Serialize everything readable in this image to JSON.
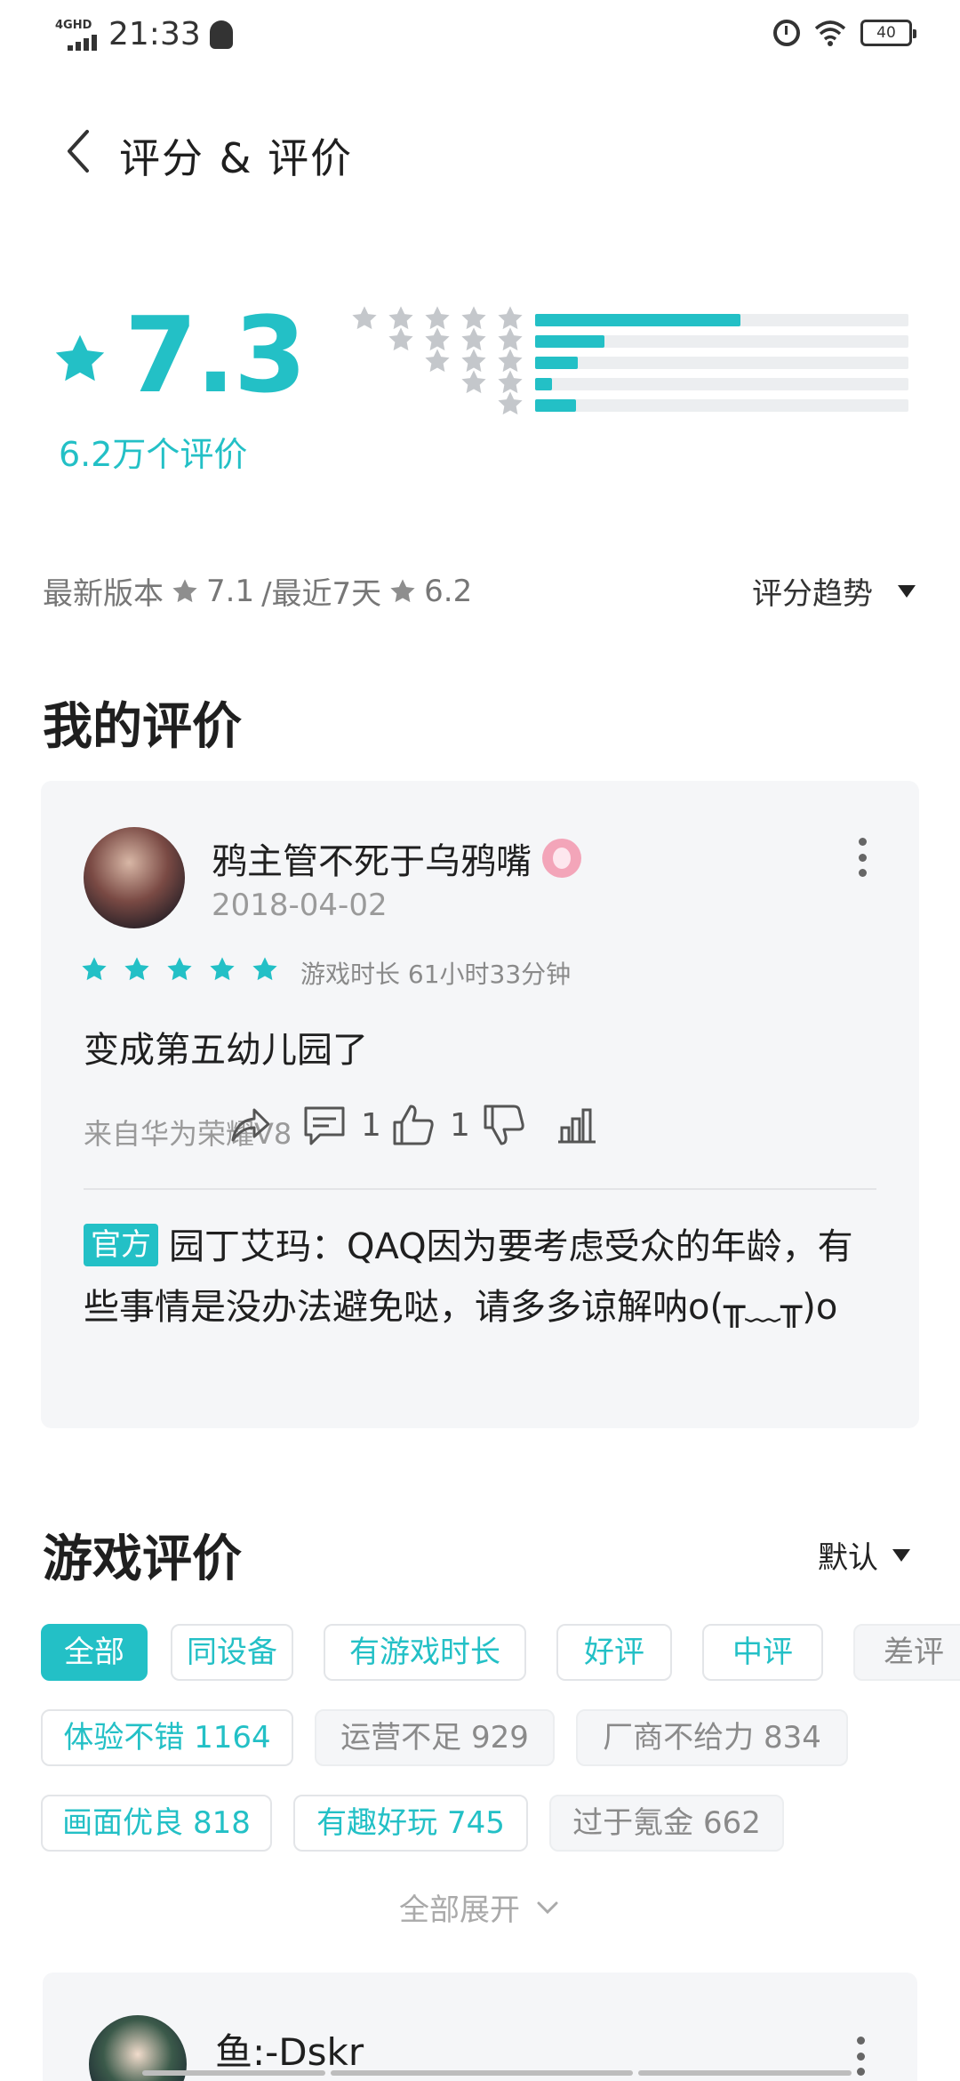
{
  "status_bar": {
    "network": "4GHD",
    "time": "21:33",
    "battery": "40"
  },
  "header": {
    "title": "评分 & 评价"
  },
  "rating": {
    "score": "7.3",
    "count_label": "6.2万个评价",
    "distribution": [
      {
        "stars": 5,
        "fraction": 0.55
      },
      {
        "stars": 4,
        "fraction": 0.185
      },
      {
        "stars": 3,
        "fraction": 0.115
      },
      {
        "stars": 2,
        "fraction": 0.045
      },
      {
        "stars": 1,
        "fraction": 0.11
      }
    ]
  },
  "version_line": {
    "latest_label": "最新版本",
    "latest_score": "7.1",
    "recent_label": "/最近7天",
    "recent_score": "6.2",
    "trend_label": "评分趋势"
  },
  "my_review": {
    "section_title": "我的评价",
    "username": "鸦主管不死于乌鸦嘴",
    "date": "2018-04-02",
    "stars": 5,
    "playtime": "游戏时长 61小时33分钟",
    "text": "变成第五幼儿园了",
    "source": "来自华为荣耀V8",
    "comment_count": "1",
    "like_count": "1",
    "official_tag": "官方",
    "official_reply": "园丁艾玛：QAQ因为要考虑受众的年龄，有些事情是没办法避免哒，请多多谅解呐o(╥﹏╥)o"
  },
  "game_reviews": {
    "section_title": "游戏评价",
    "sort_label": "默认",
    "chips": [
      {
        "label": "全部",
        "style": "active"
      },
      {
        "label": "同设备",
        "style": "teal"
      },
      {
        "label": "有游戏时长",
        "style": "teal"
      },
      {
        "label": "好评",
        "style": "teal"
      },
      {
        "label": "中评",
        "style": "teal"
      },
      {
        "label": "差评",
        "style": "gray"
      },
      {
        "label": "体验不错 1164",
        "style": "teal"
      },
      {
        "label": "运营不足 929",
        "style": "gray"
      },
      {
        "label": "厂商不给力 834",
        "style": "gray"
      },
      {
        "label": "画面优良 818",
        "style": "teal"
      },
      {
        "label": "有趣好玩 745",
        "style": "teal"
      },
      {
        "label": "过于氪金 662",
        "style": "gray"
      }
    ],
    "expand_label": "全部展开",
    "first_review": {
      "username": "鱼:-Dskr"
    }
  },
  "colors": {
    "accent": "#23c0c6",
    "star_gray": "#c4c7cb",
    "card_bg": "#f5f6f8"
  },
  "icons": [
    "back-icon",
    "star-icon",
    "share-icon",
    "comment-icon",
    "thumb-up-icon",
    "thumb-down-icon",
    "report-icon",
    "more-icon",
    "chevron-down-icon"
  ]
}
